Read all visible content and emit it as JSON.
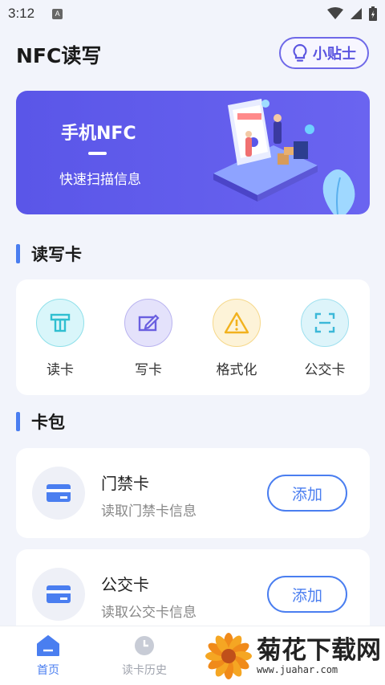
{
  "status_bar": {
    "time": "3:12",
    "notification_badge": "A"
  },
  "header": {
    "title": "NFC读写",
    "tips_label": "小贴士"
  },
  "banner": {
    "title": "手机NFC",
    "subtitle": "快速扫描信息"
  },
  "read_write": {
    "section_title": "读写卡",
    "items": [
      {
        "label": "读卡",
        "icon": "read-card-icon",
        "color": "#2fbfd0",
        "bg": "#d9f6fa"
      },
      {
        "label": "写卡",
        "icon": "write-card-icon",
        "color": "#6a5fe0",
        "bg": "#e4e2fb"
      },
      {
        "label": "格式化",
        "icon": "warning-icon",
        "color": "#f2b21e",
        "bg": "#fdf3d8"
      },
      {
        "label": "公交卡",
        "icon": "scan-icon",
        "color": "#3cb8d8",
        "bg": "#ddf4fa"
      }
    ]
  },
  "wallet": {
    "section_title": "卡包",
    "cards": [
      {
        "name": "门禁卡",
        "desc": "读取门禁卡信息",
        "action": "添加"
      },
      {
        "name": "公交卡",
        "desc": "读取公交卡信息",
        "action": "添加"
      }
    ]
  },
  "bottom_nav": {
    "items": [
      {
        "label": "首页",
        "active": true
      },
      {
        "label": "读卡历史",
        "active": false
      }
    ]
  },
  "watermark": {
    "title": "菊花下载网",
    "url": "www.juahar.com"
  },
  "colors": {
    "accent": "#5b55e0",
    "primary_blue": "#4a7ef0",
    "background": "#f2f4fb"
  }
}
